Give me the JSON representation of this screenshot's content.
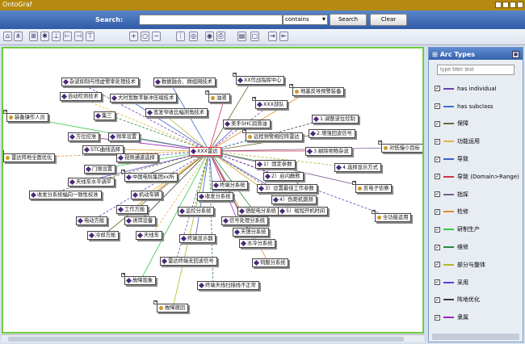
{
  "app": {
    "title": "OntoGraf"
  },
  "search": {
    "label": "Search:",
    "value": "",
    "mode": "contains",
    "search_btn": "Search",
    "clear_btn": "Clear"
  },
  "colors": {
    "selection_border": "#6dcc3e",
    "header_blue": "#3562ad",
    "title_gold": "#b58a10"
  },
  "toolbar": {
    "icons": [
      "home-icon",
      "tree-icon",
      "grid-icon",
      "snowflake-icon",
      "vertical-tree-icon",
      "horizontal-tree-icon",
      "left-tree-icon",
      "left-vertical-icon",
      "zoom-in-icon",
      "zoom-reset-icon",
      "zoom-out-icon",
      "spring-layout-icon",
      "radial-layout-icon",
      "camera-icon",
      "print-icon",
      "save-icon",
      "open-folder-icon",
      "export-icon",
      "import-icon"
    ]
  },
  "arc_panel": {
    "title": "Arc Types",
    "filter_placeholder": "type filter text",
    "items": [
      {
        "label": "has individual",
        "color": "#6a3fb5",
        "checked": true
      },
      {
        "label": "has subclass",
        "color": "#3a6fc9",
        "checked": true
      },
      {
        "label": "保障",
        "color": "#6a6a2a",
        "checked": true
      },
      {
        "label": "功能运用",
        "color": "#e2b640",
        "checked": true
      },
      {
        "label": "导致",
        "color": "#3a5fc9",
        "checked": true
      },
      {
        "label": "导致 (Domain>Range)",
        "color": "#d0324a",
        "checked": true
      },
      {
        "label": "指挥",
        "color": "#7a5a8a",
        "checked": true
      },
      {
        "label": "检修",
        "color": "#e28a2a",
        "checked": true
      },
      {
        "label": "研制生产",
        "color": "#3ac94a",
        "checked": true
      },
      {
        "label": "维修",
        "color": "#2a8a3a",
        "checked": true
      },
      {
        "label": "部分与整体",
        "color": "#b5b52a",
        "checked": true
      },
      {
        "label": "采用",
        "color": "#5a3fd5",
        "checked": true
      },
      {
        "label": "阵地优化",
        "color": "#3a3a3a",
        "checked": true
      },
      {
        "label": "隶属",
        "color": "#9a2ab5",
        "checked": true
      }
    ]
  },
  "graph": {
    "center": "XXX雷达",
    "nodes": [
      {
        "label": "杂波抑制与恒虚警率处理技术",
        "ind": false,
        "plus": false
      },
      {
        "label": "数据融合、群组网技术",
        "ind": false,
        "plus": false
      },
      {
        "label": "XX作战指挥中心",
        "ind": false,
        "plus": true
      },
      {
        "label": "自动检测技术",
        "ind": false,
        "plus": false
      },
      {
        "label": "大时宽数字脉冲压缩技术",
        "ind": false,
        "plus": false
      },
      {
        "label": "油液",
        "ind": true,
        "plus": true
      },
      {
        "label": "XXX部队",
        "ind": false,
        "plus": true
      },
      {
        "label": "地基反导预警装备",
        "ind": true,
        "plus": true
      },
      {
        "label": "装备操作人员",
        "ind": true,
        "plus": true
      },
      {
        "label": "集三",
        "ind": false,
        "plus": false
      },
      {
        "label": "宽发窄收比幅测角技术",
        "ind": false,
        "plus": false
      },
      {
        "label": "美手SHC润滑油",
        "ind": false,
        "plus": false
      },
      {
        "label": "1.调整波位控制",
        "ind": false,
        "plus": false
      },
      {
        "label": "方位控准",
        "ind": false,
        "plus": false
      },
      {
        "label": "频率设置",
        "ind": false,
        "plus": false
      },
      {
        "label": "远程预警相控阵雷达",
        "ind": true,
        "plus": true
      },
      {
        "label": "2.增强回波信号",
        "ind": false,
        "plus": false
      },
      {
        "label": "STC曲线选择",
        "ind": false,
        "plus": false
      },
      {
        "label": "视频通道选择",
        "ind": false,
        "plus": false
      },
      {
        "label": "3.剔除地物杂波",
        "ind": false,
        "plus": false
      },
      {
        "label": "对低慢小目标",
        "ind": true,
        "plus": true
      },
      {
        "label": "雷达阵地全面优化",
        "ind": true,
        "plus": true
      },
      {
        "label": "门限设置",
        "ind": false,
        "plus": false
      },
      {
        "label": "1）固定参数",
        "ind": false,
        "plus": false
      },
      {
        "label": "4.选择显示方式",
        "ind": false,
        "plus": false
      },
      {
        "label": "天线车水平调平",
        "ind": false,
        "plus": false
      },
      {
        "label": "中国电科集团xx所",
        "ind": false,
        "plus": true
      },
      {
        "label": "2）启闪静默",
        "ind": false,
        "plus": false
      },
      {
        "label": "终端分系统",
        "ind": false,
        "plus": false
      },
      {
        "label": "3）设置最佳工作参数",
        "ind": false,
        "plus": false
      },
      {
        "label": "收发分系统幅向一致性校准",
        "ind": false,
        "plus": false
      },
      {
        "label": "机动车辆",
        "ind": false,
        "plus": false
      },
      {
        "label": "收发分系统",
        "ind": false,
        "plus": false
      },
      {
        "label": "4）伪距机跳频",
        "ind": false,
        "plus": false
      },
      {
        "label": "反电子侦察",
        "ind": true,
        "plus": true
      },
      {
        "label": "工作方舱",
        "ind": false,
        "plus": false
      },
      {
        "label": "监控分系统",
        "ind": false,
        "plus": false
      },
      {
        "label": "馈配电分系统",
        "ind": false,
        "plus": false
      },
      {
        "label": "5）缩短开机时间",
        "ind": false,
        "plus": false
      },
      {
        "label": "电动方舱",
        "ind": false,
        "plus": false
      },
      {
        "label": "诱饵设备",
        "ind": false,
        "plus": false
      },
      {
        "label": "信号处理分系统",
        "ind": false,
        "plus": false
      },
      {
        "label": "全功能运用",
        "ind": true,
        "plus": true
      },
      {
        "label": "天馈分系统",
        "ind": false,
        "plus": false
      },
      {
        "label": "冷却方舱",
        "ind": false,
        "plus": false
      },
      {
        "label": "天线车",
        "ind": false,
        "plus": false
      },
      {
        "label": "终端显示器",
        "ind": false,
        "plus": false
      },
      {
        "label": "水冷分系统",
        "ind": false,
        "plus": false
      },
      {
        "label": "雷达终端无回波信号",
        "ind": false,
        "plus": false
      },
      {
        "label": "伺服分系统",
        "ind": false,
        "plus": false
      },
      {
        "label": "故障现象",
        "ind": false,
        "plus": true
      },
      {
        "label": "终端天线扫描线不正常",
        "ind": false,
        "plus": false
      },
      {
        "label": "故障原因",
        "ind": true,
        "plus": true
      }
    ]
  }
}
